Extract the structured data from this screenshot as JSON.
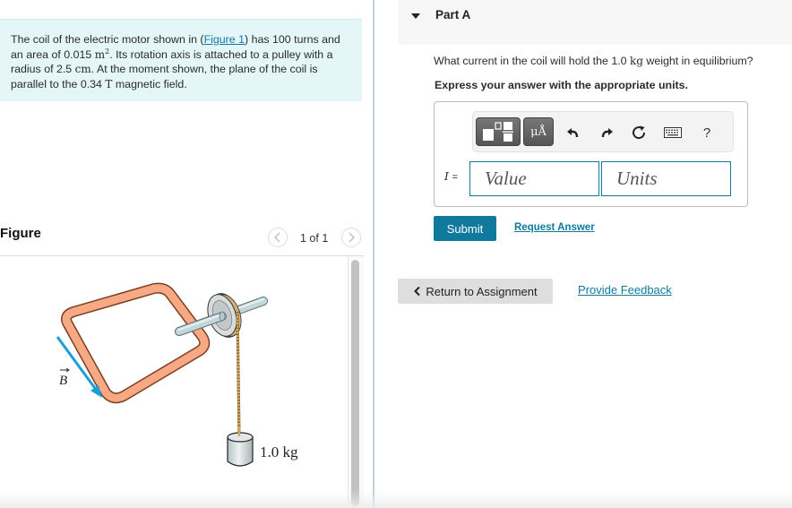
{
  "problem": {
    "text_before_link": "The coil of the electric motor shown in (",
    "link_label": "Figure 1",
    "text_after_link": ") has 100 turns and an area of 0.015 ",
    "area_unit": "m",
    "area_exp": "2",
    "text_mid1": ". Its rotation axis is attached to a pulley with a radius of 2.5 ",
    "radius_unit": "cm",
    "text_mid2": ". At the moment shown, the plane of the coil is parallel to the 0.34 ",
    "field_unit": "T",
    "text_end": " magnetic field."
  },
  "figure": {
    "title": "Figure",
    "counter": "1 of 1",
    "prev_label": "<",
    "next_label": ">",
    "field_label": "B",
    "mass_label": "1.0 kg",
    "colors": {
      "coil": "#f4a47c",
      "coil_stroke": "#8a4a2a",
      "field_arrow": "#1aa0d8",
      "axle": "#b9cdd1",
      "rope": "#d8a85a"
    }
  },
  "part": {
    "toggle_icon": "caret-down-icon",
    "title": "Part A",
    "question_before": "What current in the coil will hold the 1.0 ",
    "question_unit": "kg",
    "question_after": " weight in equilibrium?",
    "instruction": "Express your answer with the appropriate units."
  },
  "toolbar": {
    "templates_icon": "templates-icon",
    "units_label": "μÅ",
    "undo_icon": "undo-icon",
    "redo_icon": "redo-icon",
    "reset_icon": "reset-icon",
    "keyboard_icon": "keyboard-icon",
    "help_label": "?"
  },
  "answer": {
    "variable": "I",
    "equals": "=",
    "value_placeholder": "Value",
    "units_placeholder": "Units"
  },
  "actions": {
    "submit_label": "Submit",
    "request_answer_label": "Request Answer",
    "return_label": "Return to Assignment",
    "feedback_label": "Provide Feedback"
  },
  "colors": {
    "accent": "#0f7a9c",
    "problem_bg": "#e4f6f8",
    "header_bg": "#f7f7f7"
  }
}
